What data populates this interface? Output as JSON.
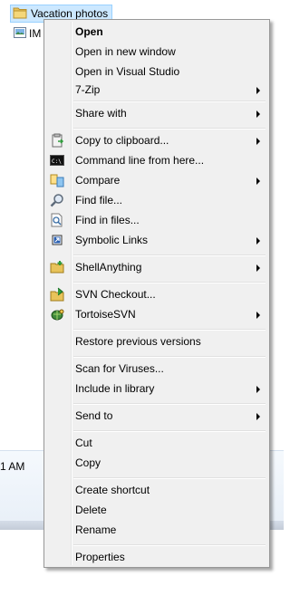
{
  "explorer": {
    "folder_name": "Vacation photos",
    "file_name_partial": "IM",
    "time_partial": "1 AM"
  },
  "menu": {
    "items": [
      {
        "id": "open",
        "label": "Open",
        "bold": true,
        "submenu": false,
        "icon": ""
      },
      {
        "id": "open-new-window",
        "label": "Open in new window",
        "submenu": false,
        "icon": ""
      },
      {
        "id": "open-visual-studio",
        "label": "Open in Visual Studio",
        "submenu": false,
        "icon": ""
      },
      {
        "id": "7zip",
        "label": "7-Zip",
        "submenu": true,
        "icon": ""
      },
      {
        "id": "share-with",
        "label": "Share with",
        "submenu": true,
        "icon": ""
      },
      {
        "id": "copy-to-clipboard",
        "label": "Copy to clipboard...",
        "submenu": true,
        "icon": "clipboard-icon"
      },
      {
        "id": "command-line",
        "label": "Command line from here...",
        "submenu": false,
        "icon": "console-icon"
      },
      {
        "id": "compare",
        "label": "Compare",
        "submenu": true,
        "icon": "compare-icon"
      },
      {
        "id": "find-file",
        "label": "Find file...",
        "submenu": false,
        "icon": "magnifier-icon"
      },
      {
        "id": "find-in-files",
        "label": "Find in files...",
        "submenu": false,
        "icon": "find-in-files-icon"
      },
      {
        "id": "symbolic-links",
        "label": "Symbolic Links",
        "submenu": true,
        "icon": "symlink-icon"
      },
      {
        "id": "shellanything",
        "label": "ShellAnything",
        "submenu": true,
        "icon": "shellanything-icon"
      },
      {
        "id": "svn-checkout",
        "label": "SVN Checkout...",
        "submenu": false,
        "icon": "svn-checkout-icon"
      },
      {
        "id": "tortoisesvn",
        "label": "TortoiseSVN",
        "submenu": true,
        "icon": "tortoisesvn-icon"
      },
      {
        "id": "restore-previous",
        "label": "Restore previous versions",
        "submenu": false,
        "icon": ""
      },
      {
        "id": "scan-viruses",
        "label": "Scan for Viruses...",
        "submenu": false,
        "icon": ""
      },
      {
        "id": "include-library",
        "label": "Include in library",
        "submenu": true,
        "icon": ""
      },
      {
        "id": "send-to",
        "label": "Send to",
        "submenu": true,
        "icon": ""
      },
      {
        "id": "cut",
        "label": "Cut",
        "submenu": false,
        "icon": ""
      },
      {
        "id": "copy",
        "label": "Copy",
        "submenu": false,
        "icon": ""
      },
      {
        "id": "create-shortcut",
        "label": "Create shortcut",
        "submenu": false,
        "icon": ""
      },
      {
        "id": "delete",
        "label": "Delete",
        "submenu": false,
        "icon": ""
      },
      {
        "id": "rename",
        "label": "Rename",
        "submenu": false,
        "icon": ""
      },
      {
        "id": "properties",
        "label": "Properties",
        "submenu": false,
        "icon": ""
      }
    ]
  }
}
